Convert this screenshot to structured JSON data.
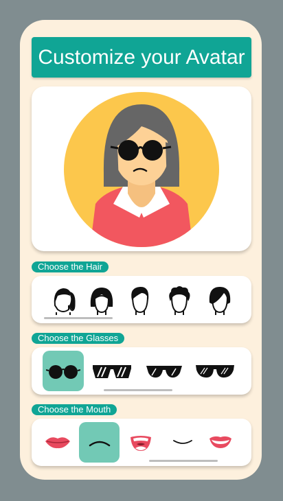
{
  "title": "Customize your Avatar",
  "colors": {
    "accent": "#10a595",
    "card_bg": "#fdf0dd",
    "page_bg": "#808d90",
    "selected": "#72c9b5",
    "avatar_circle": "#fcc74c",
    "shirt": "#f2575f",
    "skin": "#fdd196",
    "hair": "#666666"
  },
  "sections": {
    "hair": {
      "label": "Choose the Hair",
      "options": [
        "ponytail-hair-icon",
        "bob-hair-icon",
        "short-hair-icon",
        "curly-hair-icon",
        "side-swept-hair-icon"
      ]
    },
    "glasses": {
      "label": "Choose the Glasses",
      "options": [
        "round-glasses-icon",
        "striped-sunglasses-icon",
        "aviator-sunglasses-icon",
        "wayfarer-sunglasses-icon"
      ],
      "selected": "round-glasses-icon"
    },
    "mouth": {
      "label": "Choose the Mouth",
      "options": [
        "lips-icon",
        "frown-mouth-icon",
        "open-mouth-icon",
        "smile-line-icon",
        "smile-lips-icon"
      ],
      "selected": "frown-mouth-icon"
    }
  }
}
